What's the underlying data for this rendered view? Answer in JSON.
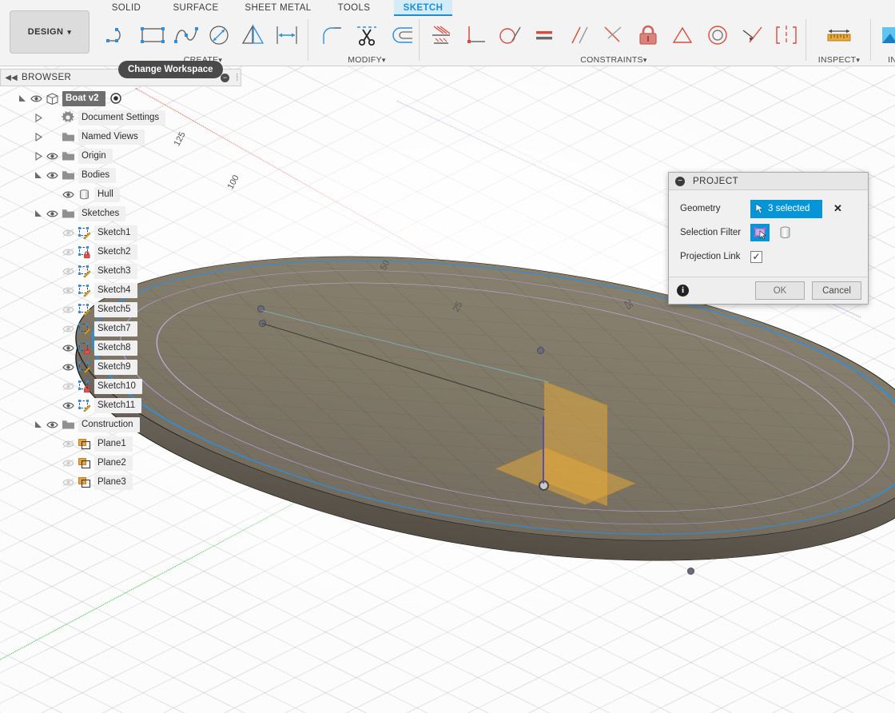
{
  "app": {
    "workspace_button": "DESIGN",
    "workspace_caret": "▾",
    "tooltip": "Change Workspace"
  },
  "tabs": [
    {
      "label": "SOLID",
      "active": false
    },
    {
      "label": "SURFACE",
      "active": false
    },
    {
      "label": "SHEET METAL",
      "active": false
    },
    {
      "label": "TOOLS",
      "active": false
    },
    {
      "label": "SKETCH",
      "active": true
    }
  ],
  "ribbon_groups": [
    {
      "name": "CREATE",
      "label": "CREATE",
      "caret": "▾",
      "tools": [
        "line-icon",
        "rectangle-icon",
        "spline-icon",
        "ellipse-icon",
        "mirror-icon",
        "dimension-icon"
      ]
    },
    {
      "name": "MODIFY",
      "label": "MODIFY",
      "caret": "▾",
      "tools": [
        "fillet-icon",
        "trim-scissors-icon",
        "offset-icon"
      ]
    },
    {
      "name": "CONSTRAINTS",
      "label": "CONSTRAINTS",
      "caret": "▾",
      "tools": [
        "coincident-icon",
        "perpendicular-icon",
        "tangent-icon",
        "equal-icon",
        "parallel-icon",
        "angle-icon",
        "fix-lock-icon",
        "midpoint-icon",
        "concentric-icon",
        "collinear-icon",
        "symmetry-icon"
      ]
    },
    {
      "name": "INSPECT",
      "label": "INSPECT",
      "caret": "▾",
      "tools": [
        "measure-ruler-icon"
      ]
    },
    {
      "name": "INSERT",
      "label": "INSE",
      "caret": "",
      "tools": [
        "insert-image-icon"
      ]
    }
  ],
  "browser": {
    "title": "BROWSER",
    "collapse_icon": "collapse-left-icon",
    "minimize_icon": "minimize-icon",
    "grip_icon": "resize-grip-icon",
    "tree": [
      {
        "label": "Boat v2",
        "indent": 0,
        "arrow": "expanded",
        "eye": "visible",
        "icon": "component-icon",
        "selected": true,
        "radio": true
      },
      {
        "label": "Document Settings",
        "indent": 1,
        "arrow": "collapsed",
        "eye": "none",
        "icon": "gear-icon",
        "selected": false,
        "radio": false
      },
      {
        "label": "Named Views",
        "indent": 1,
        "arrow": "collapsed",
        "eye": "none",
        "icon": "folder-icon",
        "selected": false,
        "radio": false
      },
      {
        "label": "Origin",
        "indent": 1,
        "arrow": "collapsed",
        "eye": "visible",
        "icon": "folder-icon",
        "selected": false,
        "radio": false
      },
      {
        "label": "Bodies",
        "indent": 1,
        "arrow": "expanded",
        "eye": "visible",
        "icon": "folder-icon",
        "selected": false,
        "radio": false
      },
      {
        "label": "Hull",
        "indent": 2,
        "arrow": "none",
        "eye": "visible",
        "icon": "body-icon",
        "selected": false,
        "radio": false
      },
      {
        "label": "Sketches",
        "indent": 1,
        "arrow": "expanded",
        "eye": "visible",
        "icon": "folder-icon",
        "selected": false,
        "radio": false
      },
      {
        "label": "Sketch1",
        "indent": 2,
        "arrow": "none",
        "eye": "hidden",
        "icon": "sketch-icon",
        "selected": false,
        "radio": false
      },
      {
        "label": "Sketch2",
        "indent": 2,
        "arrow": "none",
        "eye": "hidden",
        "icon": "sketch-locked-icon",
        "selected": false,
        "radio": false
      },
      {
        "label": "Sketch3",
        "indent": 2,
        "arrow": "none",
        "eye": "hidden",
        "icon": "sketch-icon",
        "selected": false,
        "radio": false
      },
      {
        "label": "Sketch4",
        "indent": 2,
        "arrow": "none",
        "eye": "hidden",
        "icon": "sketch-icon",
        "selected": false,
        "radio": false
      },
      {
        "label": "Sketch5",
        "indent": 2,
        "arrow": "none",
        "eye": "hidden",
        "icon": "sketch-icon",
        "selected": false,
        "radio": false
      },
      {
        "label": "Sketch7",
        "indent": 2,
        "arrow": "none",
        "eye": "hidden",
        "icon": "sketch-icon",
        "selected": false,
        "radio": false
      },
      {
        "label": "Sketch8",
        "indent": 2,
        "arrow": "none",
        "eye": "visible",
        "icon": "sketch-locked-icon",
        "selected": false,
        "radio": false
      },
      {
        "label": "Sketch9",
        "indent": 2,
        "arrow": "none",
        "eye": "visible",
        "icon": "sketch-icon",
        "selected": false,
        "radio": false
      },
      {
        "label": "Sketch10",
        "indent": 2,
        "arrow": "none",
        "eye": "hidden",
        "icon": "sketch-locked-icon",
        "selected": false,
        "radio": false
      },
      {
        "label": "Sketch11",
        "indent": 2,
        "arrow": "none",
        "eye": "visible",
        "icon": "sketch-icon",
        "selected": false,
        "radio": false
      },
      {
        "label": "Construction",
        "indent": 1,
        "arrow": "expanded",
        "eye": "visible",
        "icon": "folder-icon",
        "selected": false,
        "radio": false
      },
      {
        "label": "Plane1",
        "indent": 2,
        "arrow": "none",
        "eye": "hidden",
        "icon": "plane-icon",
        "selected": false,
        "radio": false
      },
      {
        "label": "Plane2",
        "indent": 2,
        "arrow": "none",
        "eye": "hidden",
        "icon": "plane-icon",
        "selected": false,
        "radio": false
      },
      {
        "label": "Plane3",
        "indent": 2,
        "arrow": "none",
        "eye": "hidden",
        "icon": "plane-icon",
        "selected": false,
        "radio": false
      }
    ]
  },
  "dialog": {
    "title": "PROJECT",
    "collapse_icon": "collapse-icon",
    "geometry_label": "Geometry",
    "geometry_value": "3 selected",
    "geometry_cursor_icon": "cursor-arrow-icon",
    "clear_icon": "clear-selection-icon",
    "selection_filter_label": "Selection Filter",
    "filter_sketch_icon": "filter-sketch-geometry-icon",
    "filter_body_icon": "filter-body-icon",
    "filter_sketch_active": true,
    "filter_body_active": false,
    "projection_link_label": "Projection Link",
    "projection_link_checked": true,
    "check_glyph": "✓",
    "info_icon": "info-icon",
    "ok_label": "OK",
    "cancel_label": "Cancel"
  },
  "viewport": {
    "grid_labels": [
      "125",
      "100",
      "50",
      "25",
      "25"
    ],
    "axis_x_color": "#dd4b3e",
    "axis_y_color": "#2fb541",
    "axis_z_color": "#5b50a8",
    "selected_edge_color": "#2d8fe0",
    "sketch_curve_color": "#b39ddb",
    "plane_color": "#e6aa3c",
    "body_name": "Hull"
  }
}
